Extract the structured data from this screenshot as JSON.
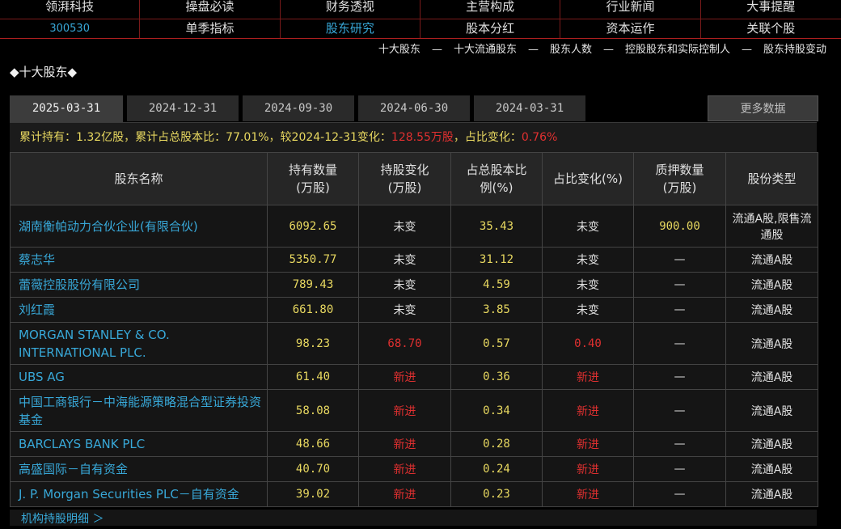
{
  "nav": {
    "row1": [
      "领湃科技",
      "操盘必读",
      "财务透视",
      "主营构成",
      "行业新闻",
      "大事提醒"
    ],
    "row2": [
      "300530",
      "单季指标",
      "股东研究",
      "股本分红",
      "资本运作",
      "关联个股"
    ]
  },
  "sublinks": [
    "十大股东",
    "十大流通股东",
    "股东人数",
    "控股股东和实际控制人",
    "股东持股变动"
  ],
  "sublinks_sep": "—",
  "section_title": "◆十大股东◆",
  "tabs": [
    "2025-03-31",
    "2024-12-31",
    "2024-09-30",
    "2024-06-30",
    "2024-03-31"
  ],
  "more_label": "更多数据",
  "summary": {
    "part1": "累计持有：1.32亿股，累计占总股本比：77.01%，较2024-12-31变化：",
    "change": "128.55万股",
    "part2": "，占比变化：",
    "ratio_change": "0.76%"
  },
  "columns": [
    "股东名称",
    "持有数量\n(万股)",
    "持股变化\n(万股)",
    "占总股本比\n例(%)",
    "占比变化(%)",
    "质押数量\n(万股)",
    "股份类型"
  ],
  "rows": [
    {
      "name": "湖南衡帕动力合伙企业(有限合伙)",
      "qty": "6092.65",
      "chg": "未变",
      "pct": "35.43",
      "pct_chg": "未变",
      "pledge": "900.00",
      "type": "流通A股,限售流通股"
    },
    {
      "name": "蔡志华",
      "qty": "5350.77",
      "chg": "未变",
      "pct": "31.12",
      "pct_chg": "未变",
      "pledge": "—",
      "type": "流通A股"
    },
    {
      "name": "蕾薇控股股份有限公司",
      "qty": "789.43",
      "chg": "未变",
      "pct": "4.59",
      "pct_chg": "未变",
      "pledge": "—",
      "type": "流通A股"
    },
    {
      "name": "刘红霞",
      "qty": "661.80",
      "chg": "未变",
      "pct": "3.85",
      "pct_chg": "未变",
      "pledge": "—",
      "type": "流通A股"
    },
    {
      "name": "MORGAN STANLEY & CO. INTERNATIONAL PLC.",
      "qty": "98.23",
      "chg": "68.70",
      "pct": "0.57",
      "pct_chg": "0.40",
      "pledge": "—",
      "type": "流通A股"
    },
    {
      "name": "UBS AG",
      "qty": "61.40",
      "chg": "新进",
      "pct": "0.36",
      "pct_chg": "新进",
      "pledge": "—",
      "type": "流通A股"
    },
    {
      "name": "中国工商银行－中海能源策略混合型证券投资基金",
      "qty": "58.08",
      "chg": "新进",
      "pct": "0.34",
      "pct_chg": "新进",
      "pledge": "—",
      "type": "流通A股"
    },
    {
      "name": "BARCLAYS BANK PLC",
      "qty": "48.66",
      "chg": "新进",
      "pct": "0.28",
      "pct_chg": "新进",
      "pledge": "—",
      "type": "流通A股"
    },
    {
      "name": "高盛国际－自有资金",
      "qty": "40.70",
      "chg": "新进",
      "pct": "0.24",
      "pct_chg": "新进",
      "pledge": "—",
      "type": "流通A股"
    },
    {
      "name": "J. P. Morgan Securities PLC－自有资金",
      "qty": "39.02",
      "chg": "新进",
      "pct": "0.23",
      "pct_chg": "新进",
      "pledge": "—",
      "type": "流通A股"
    }
  ],
  "footer_link": "机构持股明细 ＞",
  "colors": {
    "accent_blue": "#38a8d8",
    "value_yellow": "#e8d860",
    "change_red": "#e03030",
    "nav_border": "#7a1a1a"
  }
}
